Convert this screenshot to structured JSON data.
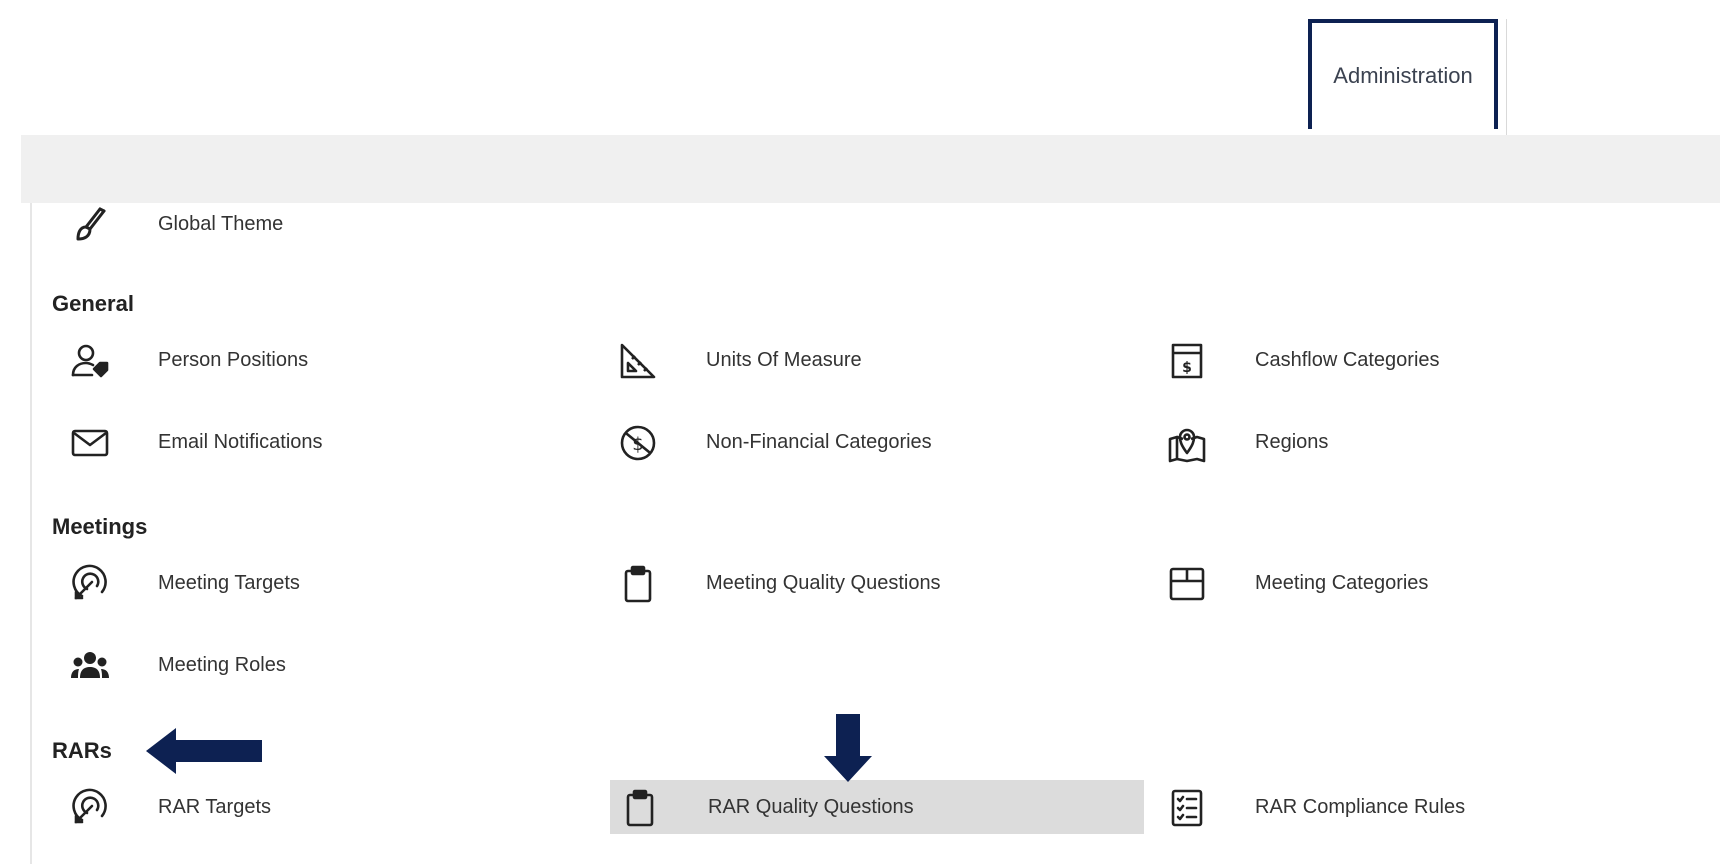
{
  "header": {
    "tab_label": "Administration"
  },
  "top_item": {
    "label": "Global Theme",
    "icon": "paintbrush-icon"
  },
  "sections": {
    "general": {
      "title": "General",
      "items": [
        {
          "label": "Person Positions",
          "icon": "person-tag-icon"
        },
        {
          "label": "Units Of Measure",
          "icon": "set-square-icon"
        },
        {
          "label": "Cashflow Categories",
          "icon": "money-box-icon"
        },
        {
          "label": "Email Notifications",
          "icon": "envelope-icon"
        },
        {
          "label": "Non-Financial Categories",
          "icon": "no-dollar-icon"
        },
        {
          "label": "Regions",
          "icon": "map-pin-icon"
        }
      ]
    },
    "meetings": {
      "title": "Meetings",
      "items": [
        {
          "label": "Meeting Targets",
          "icon": "target-arrow-icon"
        },
        {
          "label": "Meeting Quality Questions",
          "icon": "clipboard-icon"
        },
        {
          "label": "Meeting Categories",
          "icon": "box-icon"
        },
        {
          "label": "Meeting Roles",
          "icon": "users-icon"
        }
      ]
    },
    "rars": {
      "title": "RARs",
      "items": [
        {
          "label": "RAR Targets",
          "icon": "target-arrow-icon"
        },
        {
          "label": "RAR Quality Questions",
          "icon": "clipboard-icon"
        },
        {
          "label": "RAR Compliance Rules",
          "icon": "checklist-icon"
        }
      ]
    }
  },
  "colors": {
    "accent": "#0d2152",
    "highlight": "#dcdcdc",
    "band": "#f0f0f0"
  }
}
